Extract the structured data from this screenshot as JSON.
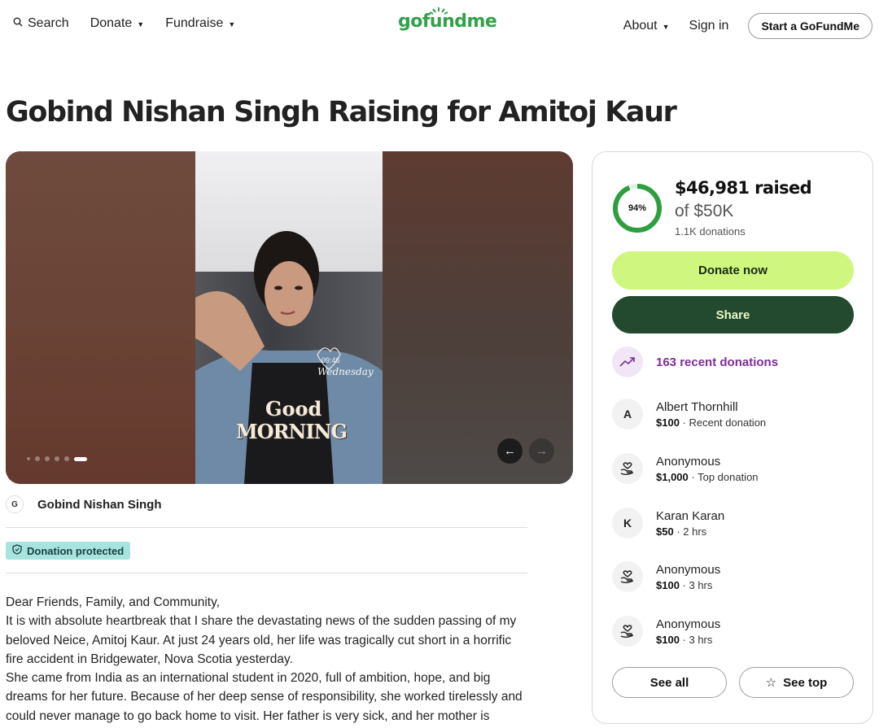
{
  "header": {
    "search_label": "Search",
    "donate_label": "Donate",
    "fundraise_label": "Fundraise",
    "logo_text": "gofundme",
    "about_label": "About",
    "signin_label": "Sign in",
    "start_label": "Start a GoFundMe"
  },
  "page": {
    "title": "Gobind Nishan Singh Raising for Amitoj Kaur"
  },
  "hero": {
    "photo_time": "09:46",
    "photo_day": "Wednesday",
    "photo_text_1": "Good",
    "photo_text_2": "MORNING",
    "slide_count": 6,
    "active_slide": 6,
    "prev_icon": "←",
    "next_icon": "→"
  },
  "organizer": {
    "avatar_initial": "G",
    "name": "Gobind Nishan Singh"
  },
  "badge": {
    "label": "Donation protected"
  },
  "story": {
    "lines": [
      "Dear Friends, Family, and Community,",
      "It is with absolute heartbreak that I share the devastating news of the sudden passing of my beloved Neice, Amitoj Kaur. At just 24 years old, her life was tragically cut short in a horrific fire accident in Bridgewater, Nova Scotia yesterday.",
      "She came from India as an international student in 2020, full of ambition, hope, and big dreams for her future. Because of her deep sense of responsibility, she worked tirelessly and could never manage to go back home to visit. Her father is very sick, and her mother is"
    ]
  },
  "fundraiser": {
    "percent": 94,
    "percent_label": "94%",
    "raised": "$46,981 raised",
    "goal": "of $50K",
    "donation_count": "1.1K donations",
    "donate_label": "Donate now",
    "share_label": "Share",
    "recent_label": "163 recent donations",
    "ring_color": "#2f9e3f",
    "ring_track_color": "#e6efe6"
  },
  "donors": [
    {
      "initial": "A",
      "name": "Albert Thornhill",
      "amount": "$100",
      "note": " · Recent donation",
      "icon": "letter-avatar"
    },
    {
      "initial": "",
      "name": "Anonymous",
      "amount": "$1,000",
      "note": " · Top donation",
      "icon": "heart-hand-icon"
    },
    {
      "initial": "K",
      "name": "Karan Karan",
      "amount": "$50",
      "note": " · 2 hrs",
      "icon": "letter-avatar"
    },
    {
      "initial": "",
      "name": "Anonymous",
      "amount": "$100",
      "note": " · 3 hrs",
      "icon": "heart-hand-icon"
    },
    {
      "initial": "",
      "name": "Anonymous",
      "amount": "$100",
      "note": " · 3 hrs",
      "icon": "heart-hand-icon"
    }
  ],
  "actions": {
    "see_all_label": "See all",
    "see_top_label": "See top"
  }
}
